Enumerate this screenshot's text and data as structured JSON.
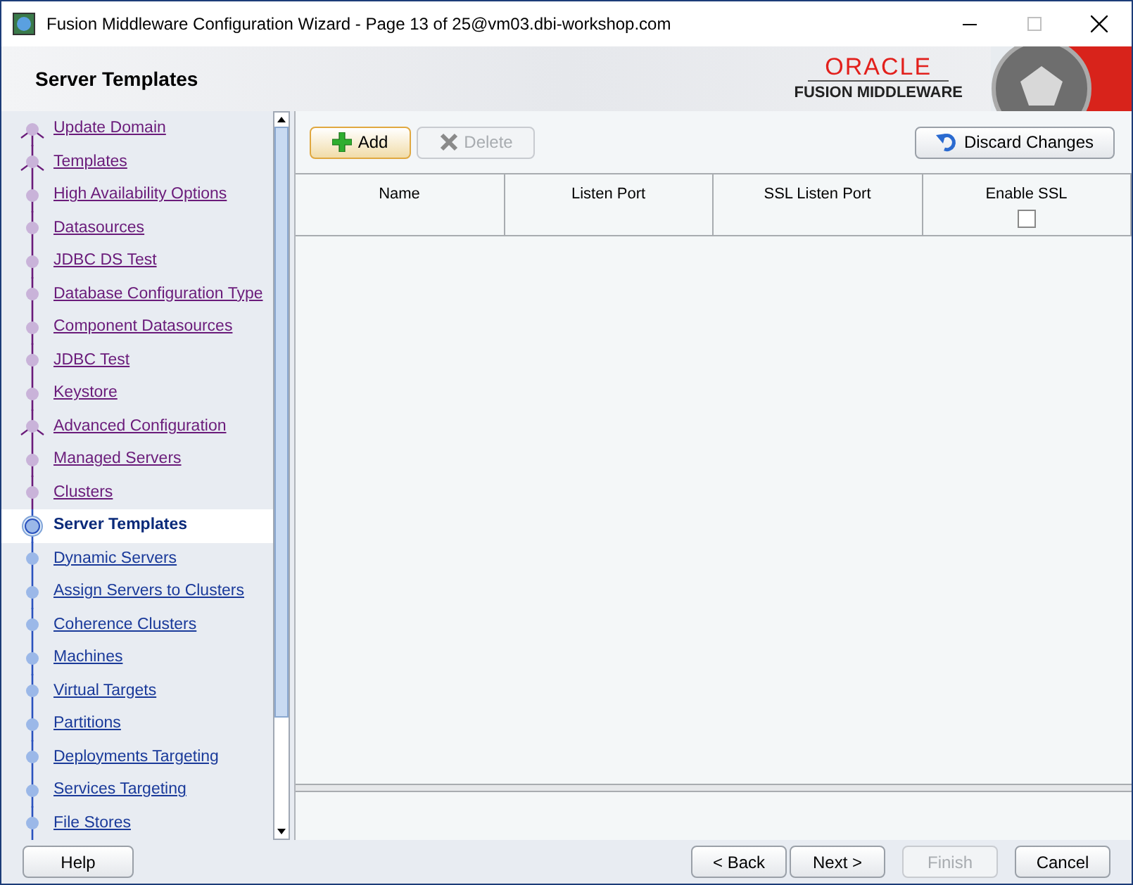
{
  "window": {
    "title": "Fusion Middleware Configuration Wizard - Page 13 of 25@vm03.dbi-workshop.com"
  },
  "header": {
    "title": "Server Templates",
    "logo": {
      "brand": "ORACLE",
      "product": "FUSION MIDDLEWARE"
    }
  },
  "steps": [
    {
      "label": "Update Domain",
      "visited": true,
      "selected": false,
      "branch": true
    },
    {
      "label": "Templates",
      "visited": true,
      "selected": false,
      "branch": true
    },
    {
      "label": "High Availability Options",
      "visited": true,
      "selected": false,
      "branch": false
    },
    {
      "label": "Datasources",
      "visited": true,
      "selected": false,
      "branch": false
    },
    {
      "label": "JDBC DS Test",
      "visited": true,
      "selected": false,
      "branch": false
    },
    {
      "label": "Database Configuration Type",
      "visited": true,
      "selected": false,
      "branch": false
    },
    {
      "label": "Component Datasources",
      "visited": true,
      "selected": false,
      "branch": false
    },
    {
      "label": "JDBC Test",
      "visited": true,
      "selected": false,
      "branch": false
    },
    {
      "label": "Keystore",
      "visited": true,
      "selected": false,
      "branch": false
    },
    {
      "label": "Advanced Configuration",
      "visited": true,
      "selected": false,
      "branch": true
    },
    {
      "label": "Managed Servers",
      "visited": true,
      "selected": false,
      "branch": false
    },
    {
      "label": "Clusters",
      "visited": true,
      "selected": false,
      "branch": false
    },
    {
      "label": "Server Templates",
      "visited": false,
      "selected": true,
      "branch": false
    },
    {
      "label": "Dynamic Servers",
      "visited": false,
      "selected": false,
      "branch": false
    },
    {
      "label": "Assign Servers to Clusters",
      "visited": false,
      "selected": false,
      "branch": false
    },
    {
      "label": "Coherence Clusters",
      "visited": false,
      "selected": false,
      "branch": false
    },
    {
      "label": "Machines",
      "visited": false,
      "selected": false,
      "branch": false
    },
    {
      "label": "Virtual Targets",
      "visited": false,
      "selected": false,
      "branch": false
    },
    {
      "label": "Partitions",
      "visited": false,
      "selected": false,
      "branch": false
    },
    {
      "label": "Deployments Targeting",
      "visited": false,
      "selected": false,
      "branch": false
    },
    {
      "label": "Services Targeting",
      "visited": false,
      "selected": false,
      "branch": false
    },
    {
      "label": "File Stores",
      "visited": false,
      "selected": false,
      "branch": false
    }
  ],
  "toolbar": {
    "add": {
      "label": "Add",
      "disabled": false
    },
    "delete": {
      "label": "Delete",
      "disabled": true
    },
    "discard": {
      "label": "Discard Changes",
      "disabled": false
    }
  },
  "table": {
    "columns": [
      {
        "label": "Name"
      },
      {
        "label": "Listen Port"
      },
      {
        "label": "SSL Listen Port"
      },
      {
        "label": "Enable SSL",
        "checkbox": true,
        "checked": false
      }
    ]
  },
  "buttons": [
    {
      "label": "Help",
      "disabled": false
    },
    {
      "label": "< Back",
      "disabled": false
    },
    {
      "label": "Next >",
      "disabled": false
    },
    {
      "label": "Finish",
      "disabled": true
    },
    {
      "label": "Cancel",
      "disabled": false
    }
  ]
}
